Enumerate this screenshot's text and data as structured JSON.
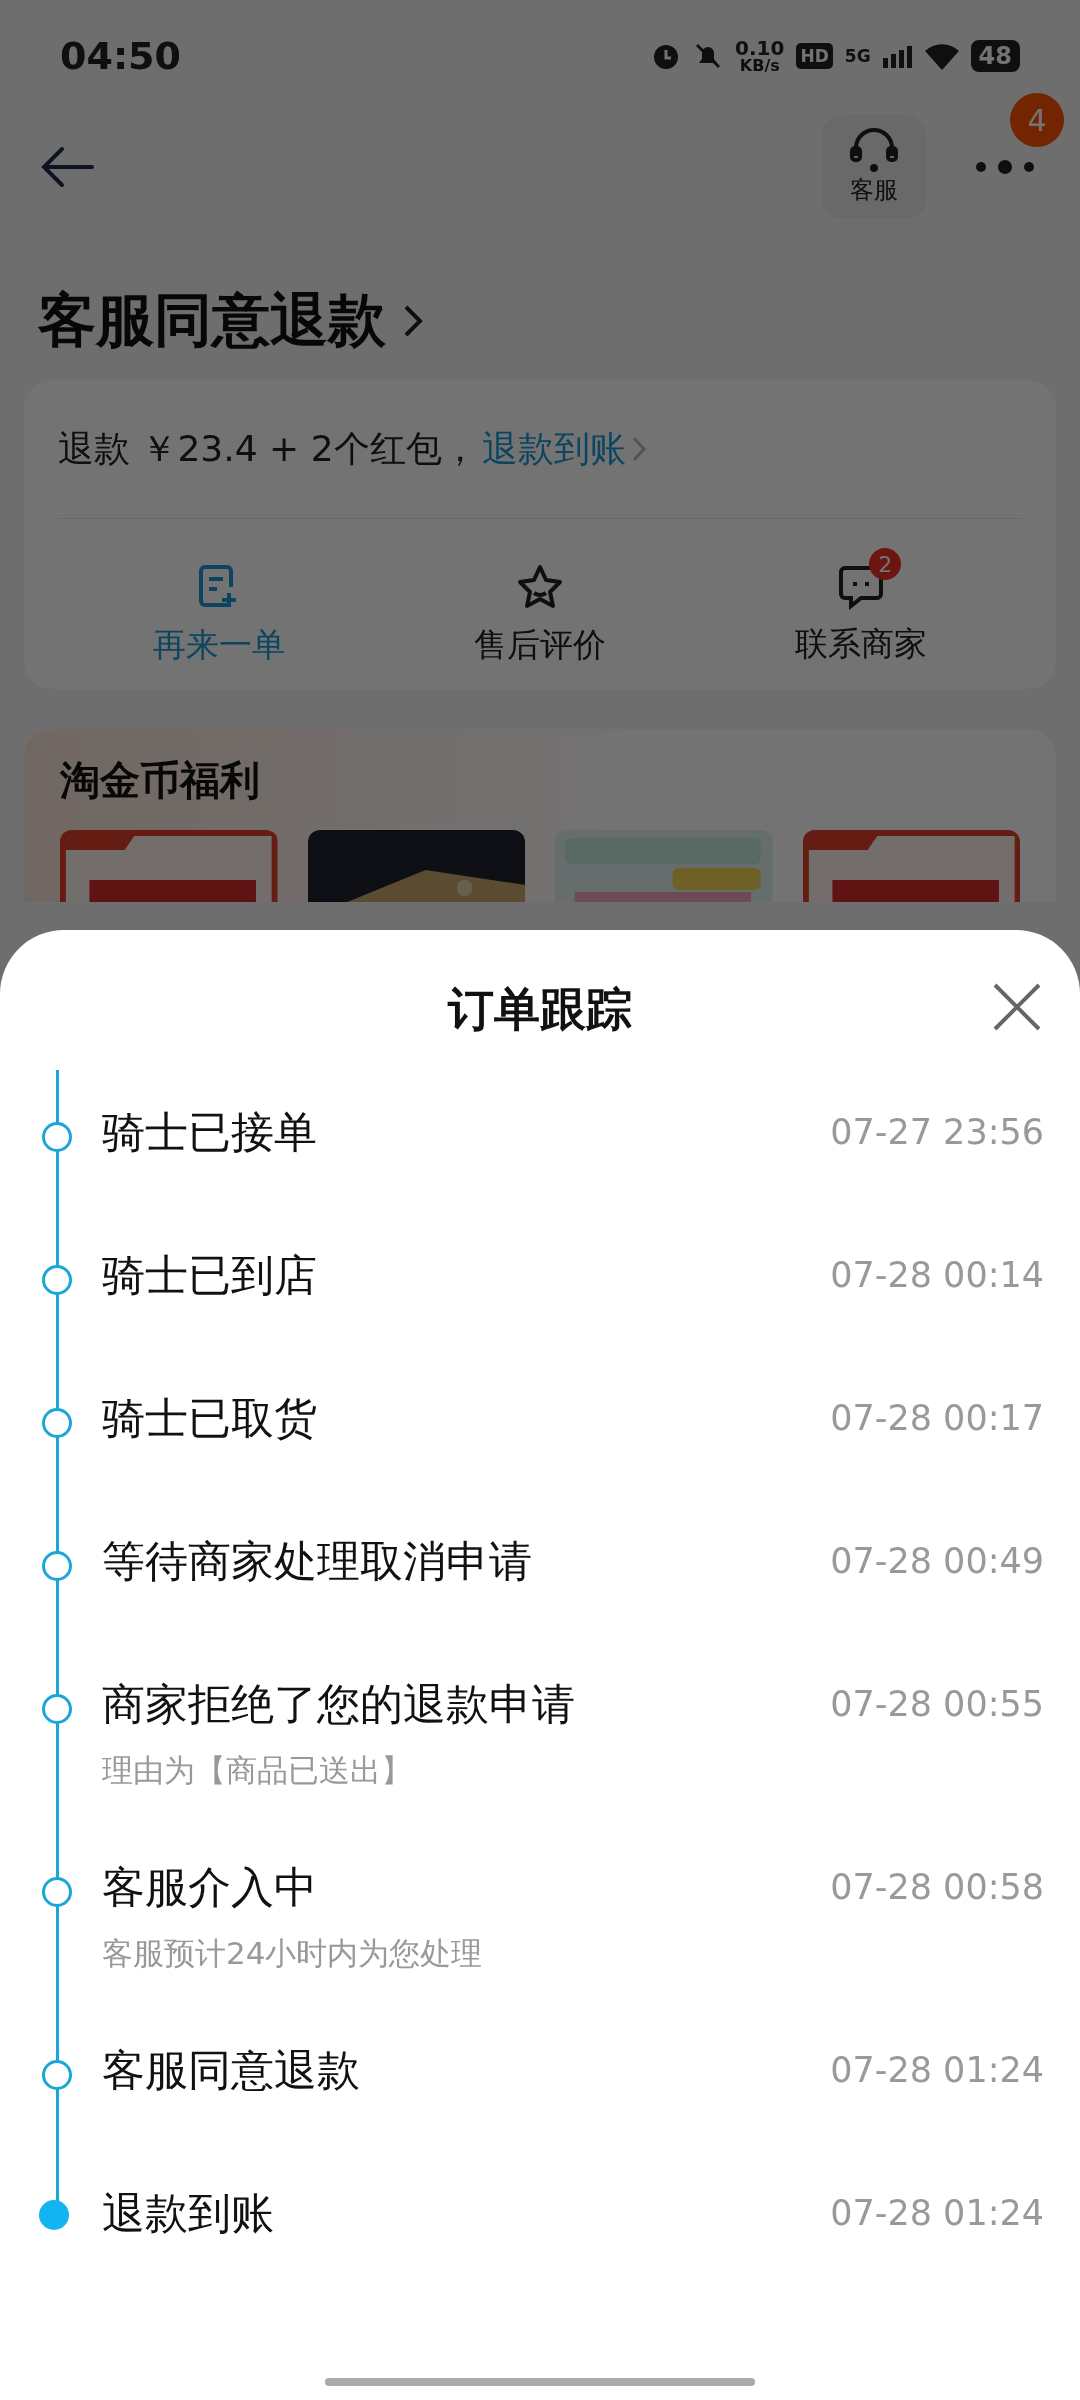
{
  "status_bar": {
    "time": "04:50",
    "net_speed": "0.10",
    "net_unit": "KB/s",
    "hd": "HD",
    "network": "5G",
    "battery": "48"
  },
  "header": {
    "service_label": "客服",
    "more_badge": "4"
  },
  "status_title": "客服同意退款",
  "refund": {
    "text": "退款 ￥23.4 + 2个红包，",
    "link": "退款到账"
  },
  "actions": [
    {
      "kind": "reorder",
      "label": "再来一单",
      "highlighted": true
    },
    {
      "kind": "review",
      "label": "售后评价",
      "highlighted": false
    },
    {
      "kind": "contact",
      "label": "联系商家",
      "highlighted": false,
      "badge": "2"
    }
  ],
  "coins_section": {
    "title": "淘金币福利"
  },
  "sheet": {
    "title": "订单跟踪",
    "events": [
      {
        "title": "骑士已接单",
        "time": "07-27 23:56",
        "current": false
      },
      {
        "title": "骑士已到店",
        "time": "07-28 00:14",
        "current": false
      },
      {
        "title": "骑士已取货",
        "time": "07-28 00:17",
        "current": false
      },
      {
        "title": "等待商家处理取消申请",
        "time": "07-28 00:49",
        "current": false
      },
      {
        "title": "商家拒绝了您的退款申请",
        "time": "07-28 00:55",
        "note": "理由为【商品已送出】",
        "current": false
      },
      {
        "title": "客服介入中",
        "time": "07-28 00:58",
        "note": "客服预计24小时内为您处理",
        "current": false
      },
      {
        "title": "客服同意退款",
        "time": "07-28 01:24",
        "current": false
      },
      {
        "title": "退款到账",
        "time": "07-28 01:24",
        "current": true
      }
    ]
  }
}
